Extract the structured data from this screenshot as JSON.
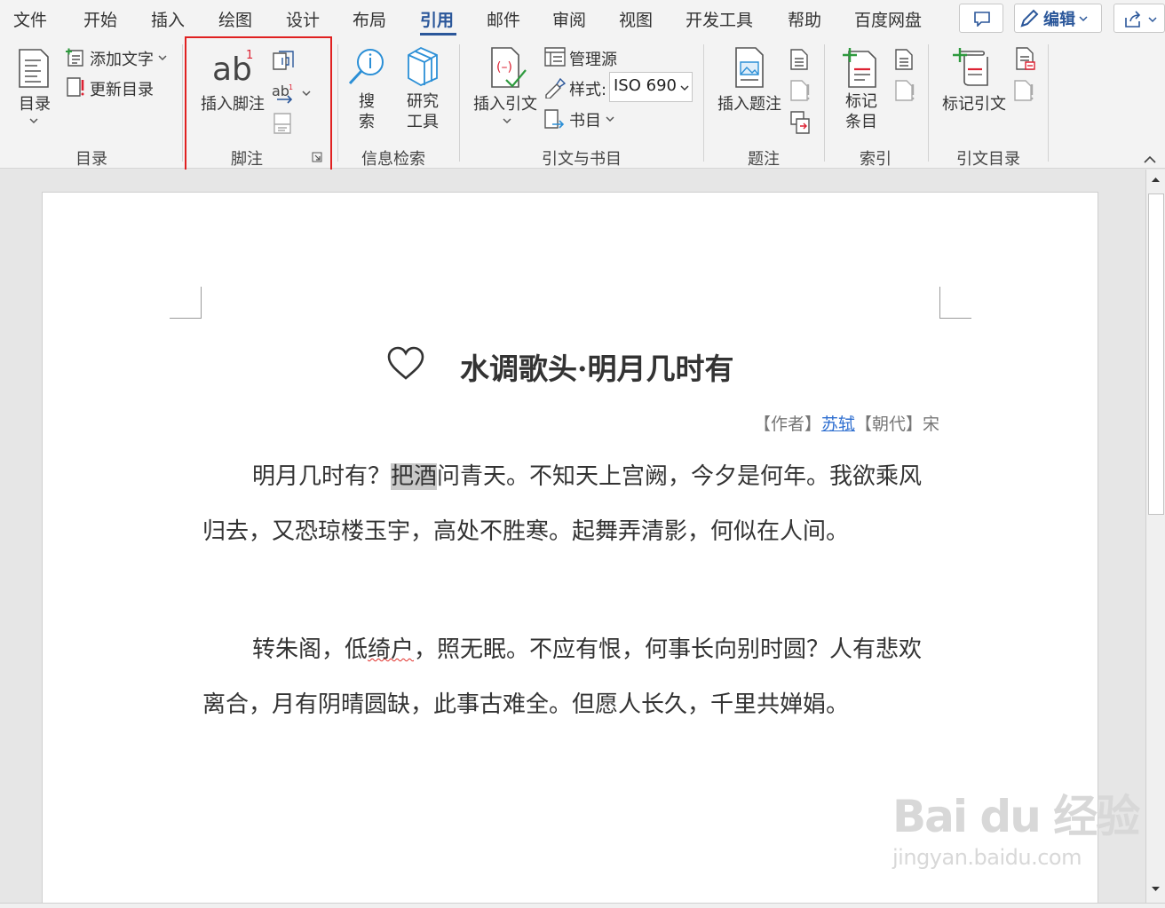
{
  "tabs": [
    {
      "label": "文件",
      "active": false
    },
    {
      "label": "开始",
      "active": false
    },
    {
      "label": "插入",
      "active": false
    },
    {
      "label": "绘图",
      "active": false
    },
    {
      "label": "设计",
      "active": false
    },
    {
      "label": "布局",
      "active": false
    },
    {
      "label": "引用",
      "active": true
    },
    {
      "label": "邮件",
      "active": false
    },
    {
      "label": "审阅",
      "active": false
    },
    {
      "label": "视图",
      "active": false
    },
    {
      "label": "开发工具",
      "active": false
    },
    {
      "label": "帮助",
      "active": false
    },
    {
      "label": "百度网盘",
      "active": false
    }
  ],
  "titlebar": {
    "edit_label": "编辑"
  },
  "ribbon": {
    "toc": {
      "button": "目录",
      "add_text": "添加文字",
      "update": "更新目录",
      "group": "目录"
    },
    "footnotes": {
      "insert": "插入脚注",
      "group": "脚注"
    },
    "research": {
      "search": "搜索",
      "tools": "研究工具",
      "group": "信息检索"
    },
    "citations": {
      "insert": "插入引文",
      "manage": "管理源",
      "style_label": "样式:",
      "style_value": "ISO 690",
      "bibliography": "书目",
      "group": "引文与书目"
    },
    "captions": {
      "insert": "插入题注",
      "group": "题注"
    },
    "index": {
      "mark": "标记条目",
      "group": "索引"
    },
    "toa": {
      "mark": "标记引文",
      "group": "引文目录"
    }
  },
  "document": {
    "title": "水调歌头·明月几时有",
    "meta_prefix": "【作者】",
    "author": "苏轼",
    "meta_dynasty_label": "【朝代】",
    "dynasty": "宋",
    "p1_before": "明月几时有？",
    "p1_highlight": "把酒",
    "p1_after": "问青天。不知天上宫阙，今夕是何年。我欲乘风归去，又恐琼楼玉宇，高处不胜寒。起舞弄清影，何似在人间。",
    "p2_before": "转朱阁，低",
    "p2_squiggle": "绮户",
    "p2_after": "，照无眠。不应有恨，何事长向别时圆？人有悲欢离合，月有阴晴圆缺，此事古难全。但愿人长久，千里共婵娟。"
  },
  "watermark": {
    "big": "Bai du 经验",
    "small": "jingyan.baidu.com"
  },
  "colors": {
    "accent": "#2b579a",
    "highlight_box": "#e02020",
    "link": "#2f6fd0"
  }
}
